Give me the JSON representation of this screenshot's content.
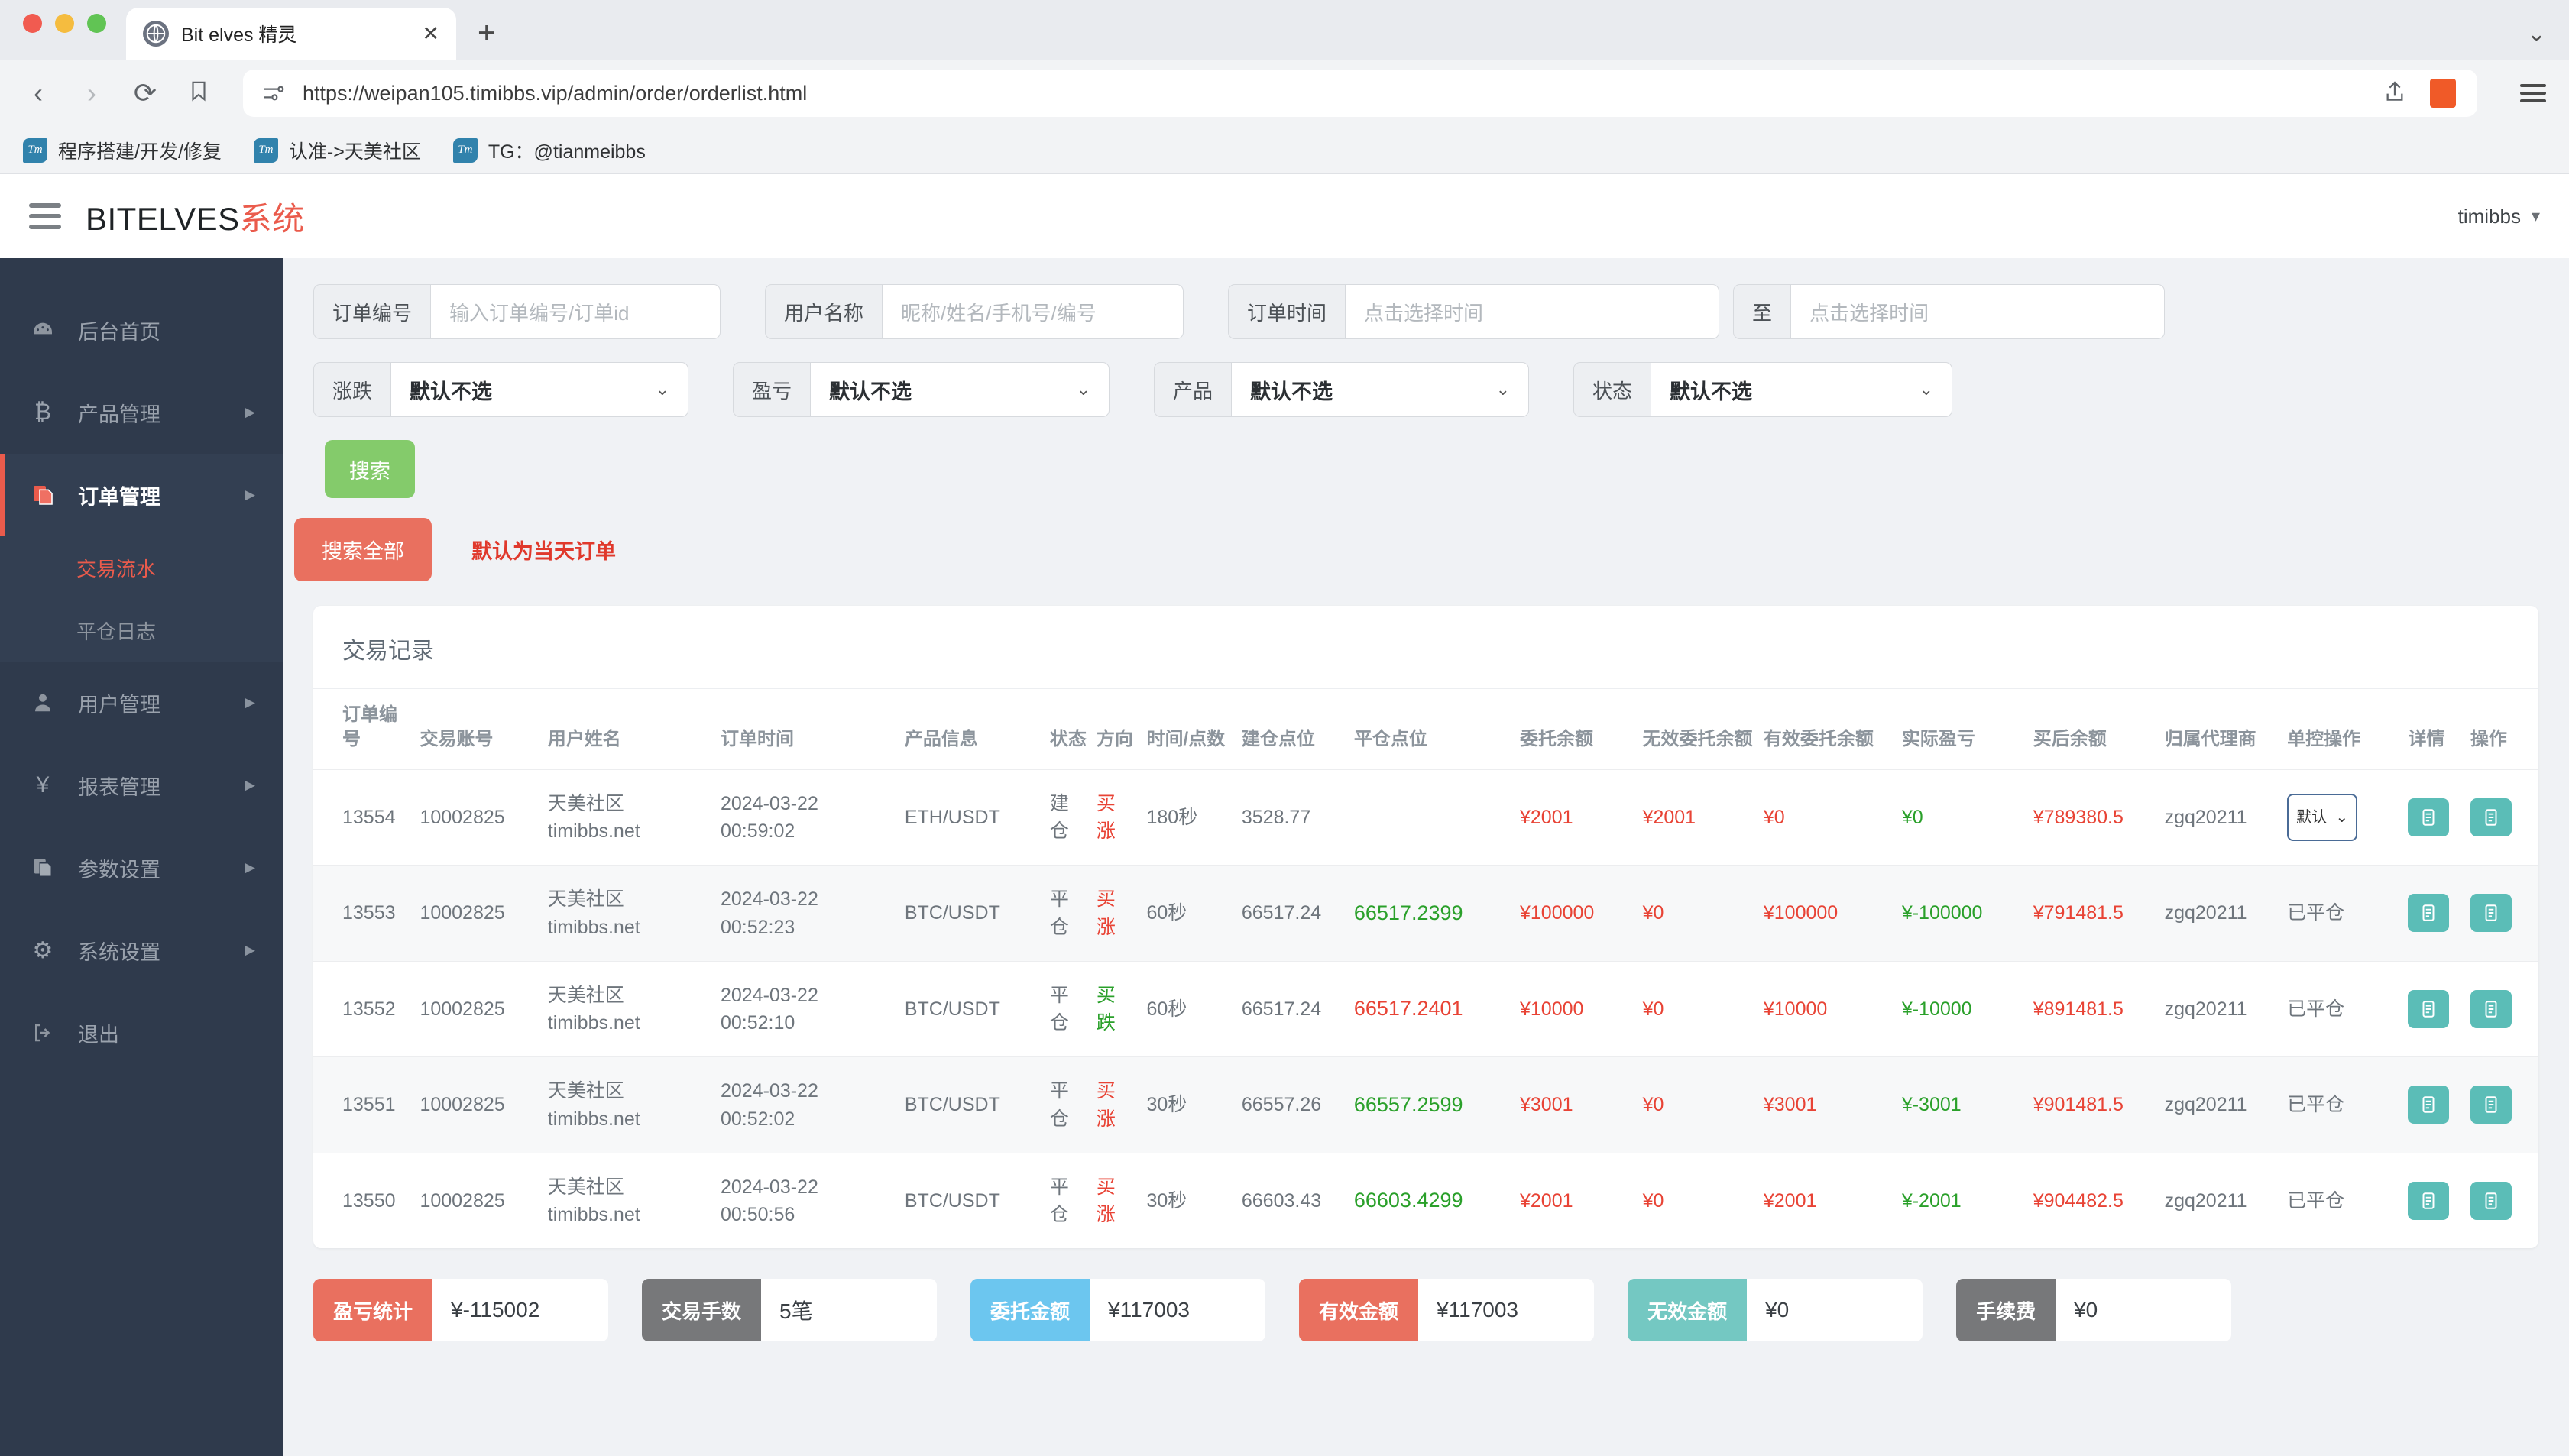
{
  "browser": {
    "tab": {
      "title": "Bit elves 精灵",
      "close_label": "✕",
      "favicon": "globe-icon"
    },
    "new_tab_label": "+",
    "nav": {
      "back": "‹",
      "forward": "›",
      "reload": "⟳",
      "bookmark": "bookmark-icon"
    },
    "url": "https://weipan105.timibbs.vip/admin/order/orderlist.html",
    "bookmarks": [
      {
        "icon_text": "Tm",
        "label": "程序搭建/开发/修复"
      },
      {
        "icon_text": "Tm",
        "label": "认准->天美社区"
      },
      {
        "icon_text": "Tm",
        "label": "TG：@tianmeibbs"
      }
    ]
  },
  "header": {
    "brand_en": "BITELVES",
    "brand_cn": "系统",
    "user": "timibbs",
    "user_caret": "▾"
  },
  "sidebar": {
    "items": [
      {
        "label": "后台首页",
        "icon": "dashboard-icon",
        "glyph": "◔",
        "arrow": ""
      },
      {
        "label": "产品管理",
        "icon": "bitcoin-icon",
        "glyph": "₿",
        "arrow": "▶"
      },
      {
        "label": "订单管理",
        "icon": "orders-icon",
        "glyph": "❐",
        "arrow": "▶"
      },
      {
        "label": "用户管理",
        "icon": "user-icon",
        "glyph": "👤",
        "arrow": "▶"
      },
      {
        "label": "报表管理",
        "icon": "yen-icon",
        "glyph": "¥",
        "arrow": "▶"
      },
      {
        "label": "参数设置",
        "icon": "params-icon",
        "glyph": "❐",
        "arrow": "▶"
      },
      {
        "label": "系统设置",
        "icon": "gear-icon",
        "glyph": "⚙",
        "arrow": "▶"
      },
      {
        "label": "退出",
        "icon": "logout-icon",
        "glyph": "⇥",
        "arrow": ""
      }
    ],
    "sub_items": [
      {
        "label": "交易流水",
        "active": true
      },
      {
        "label": "平仓日志",
        "active": false
      }
    ]
  },
  "filters": {
    "order_no": {
      "label": "订单编号",
      "placeholder": "输入订单编号/订单id",
      "value": ""
    },
    "user_name": {
      "label": "用户名称",
      "placeholder": "昵称/姓名/手机号/编号",
      "value": ""
    },
    "order_time": {
      "label": "订单时间",
      "placeholder": "点击选择时间",
      "value": ""
    },
    "order_time_to": {
      "label": "至",
      "placeholder": "点击选择时间",
      "value": ""
    },
    "updown": {
      "label": "涨跌",
      "value": "默认不选",
      "caret": "⌄"
    },
    "profit": {
      "label": "盈亏",
      "value": "默认不选",
      "caret": "⌄"
    },
    "product": {
      "label": "产品",
      "value": "默认不选",
      "caret": "⌄"
    },
    "status": {
      "label": "状态",
      "value": "默认不选",
      "caret": "⌄"
    },
    "search_button": "搜索",
    "search_all_button": "搜索全部",
    "hint": "默认为当天订单"
  },
  "table": {
    "title": "交易记录",
    "columns": [
      "订单编号",
      "交易账号",
      "用户姓名",
      "订单时间",
      "产品信息",
      "状态",
      "方向",
      "时间/点数",
      "建仓点位",
      "平仓点位",
      "委托余额",
      "无效委托余额",
      "有效委托余额",
      "实际盈亏",
      "买后余额",
      "归属代理商",
      "单控操作",
      "详情",
      "操作"
    ],
    "rows": [
      {
        "order_no": "13554",
        "account": "10002825",
        "user_line1": "天美社区",
        "user_line2": "timibbs.net",
        "time_line1": "2024-03-22",
        "time_line2": "00:59:02",
        "product": "ETH/USDT",
        "status_l1": "建",
        "status_l2": "仓",
        "dir_l1": "买",
        "dir_l2": "涨",
        "dir_color": "red",
        "duration": "180秒",
        "open_point": "3528.77",
        "close_point": "",
        "close_color": "",
        "entrust_bal": "¥2001",
        "invalid_bal": "¥2001",
        "valid_bal": "¥0",
        "real_pnl": "¥0",
        "real_pnl_color": "green",
        "after_bal": "¥789380.5",
        "agent": "zgq20211",
        "control": "select",
        "control_text": "默认",
        "control_caret": "⌄"
      },
      {
        "order_no": "13553",
        "account": "10002825",
        "user_line1": "天美社区",
        "user_line2": "timibbs.net",
        "time_line1": "2024-03-22",
        "time_line2": "00:52:23",
        "product": "BTC/USDT",
        "status_l1": "平",
        "status_l2": "仓",
        "dir_l1": "买",
        "dir_l2": "涨",
        "dir_color": "red",
        "duration": "60秒",
        "open_point": "66517.24",
        "close_point": "66517.2399",
        "close_color": "green",
        "entrust_bal": "¥100000",
        "invalid_bal": "¥0",
        "valid_bal": "¥100000",
        "real_pnl": "¥-100000",
        "real_pnl_color": "green",
        "after_bal": "¥791481.5",
        "agent": "zgq20211",
        "control": "text",
        "control_text": "已平仓"
      },
      {
        "order_no": "13552",
        "account": "10002825",
        "user_line1": "天美社区",
        "user_line2": "timibbs.net",
        "time_line1": "2024-03-22",
        "time_line2": "00:52:10",
        "product": "BTC/USDT",
        "status_l1": "平",
        "status_l2": "仓",
        "dir_l1": "买",
        "dir_l2": "跌",
        "dir_color": "green",
        "duration": "60秒",
        "open_point": "66517.24",
        "close_point": "66517.2401",
        "close_color": "red",
        "entrust_bal": "¥10000",
        "invalid_bal": "¥0",
        "valid_bal": "¥10000",
        "real_pnl": "¥-10000",
        "real_pnl_color": "green",
        "after_bal": "¥891481.5",
        "agent": "zgq20211",
        "control": "text",
        "control_text": "已平仓"
      },
      {
        "order_no": "13551",
        "account": "10002825",
        "user_line1": "天美社区",
        "user_line2": "timibbs.net",
        "time_line1": "2024-03-22",
        "time_line2": "00:52:02",
        "product": "BTC/USDT",
        "status_l1": "平",
        "status_l2": "仓",
        "dir_l1": "买",
        "dir_l2": "涨",
        "dir_color": "red",
        "duration": "30秒",
        "open_point": "66557.26",
        "close_point": "66557.2599",
        "close_color": "green",
        "entrust_bal": "¥3001",
        "invalid_bal": "¥0",
        "valid_bal": "¥3001",
        "real_pnl": "¥-3001",
        "real_pnl_color": "green",
        "after_bal": "¥901481.5",
        "agent": "zgq20211",
        "control": "text",
        "control_text": "已平仓"
      },
      {
        "order_no": "13550",
        "account": "10002825",
        "user_line1": "天美社区",
        "user_line2": "timibbs.net",
        "time_line1": "2024-03-22",
        "time_line2": "00:50:56",
        "product": "BTC/USDT",
        "status_l1": "平",
        "status_l2": "仓",
        "dir_l1": "买",
        "dir_l2": "涨",
        "dir_color": "red",
        "duration": "30秒",
        "open_point": "66603.43",
        "close_point": "66603.4299",
        "close_color": "green",
        "entrust_bal": "¥2001",
        "invalid_bal": "¥0",
        "valid_bal": "¥2001",
        "real_pnl": "¥-2001",
        "real_pnl_color": "green",
        "after_bal": "¥904482.5",
        "agent": "zgq20211",
        "control": "text",
        "control_text": "已平仓"
      }
    ]
  },
  "summary": [
    {
      "label": "盈亏统计",
      "value": "¥-115002",
      "color_class": "c-salmon"
    },
    {
      "label": "交易手数",
      "value": "5笔",
      "color_class": "c-gray"
    },
    {
      "label": "委托金额",
      "value": "¥117003",
      "color_class": "c-blue"
    },
    {
      "label": "有效金额",
      "value": "¥117003",
      "color_class": "c-salmon"
    },
    {
      "label": "无效金额",
      "value": "¥0",
      "color_class": "c-teal"
    },
    {
      "label": "手续费",
      "value": "¥0",
      "color_class": "c-gray"
    }
  ],
  "colors": {
    "accent_red": "#ea5b4c",
    "green_btn": "#84cb6b",
    "sidebar_bg": "#2f3a4c",
    "teal_btn": "#5bbdb7",
    "up_red": "#e84335",
    "down_green": "#2aa02a"
  }
}
